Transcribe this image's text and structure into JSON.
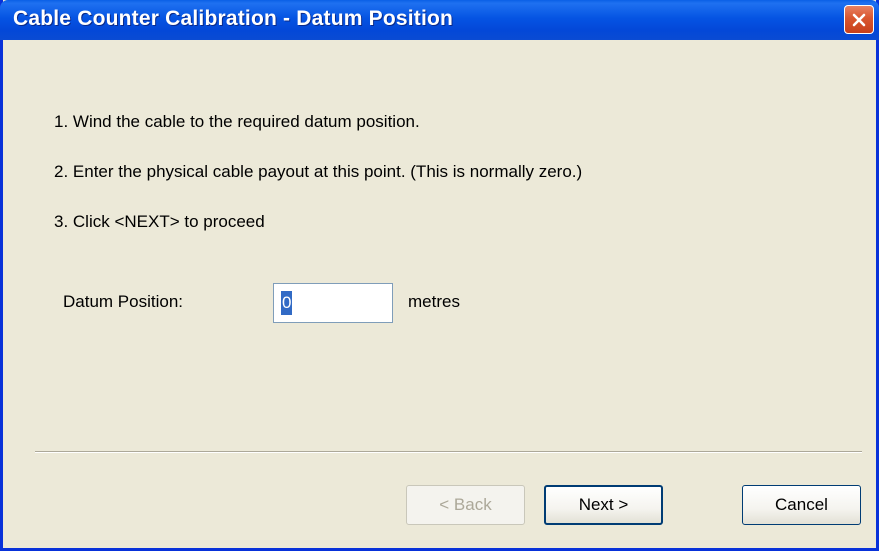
{
  "window": {
    "title": "Cable Counter Calibration - Datum Position"
  },
  "instructions": [
    "1. Wind the cable to the required datum position.",
    "2. Enter the physical cable payout at this point. (This is normally zero.)",
    "3. Click <NEXT> to proceed"
  ],
  "datum": {
    "label": "Datum Position:",
    "value": "0",
    "unit": "metres"
  },
  "buttons": {
    "back": "< Back",
    "next": "Next >",
    "cancel": "Cancel"
  },
  "colors": {
    "titlebar": "#0554e3",
    "window_bg": "#ece9d8",
    "close_button": "#d9562f",
    "selection": "#316ac5"
  },
  "icons": {
    "close": "close-icon"
  }
}
